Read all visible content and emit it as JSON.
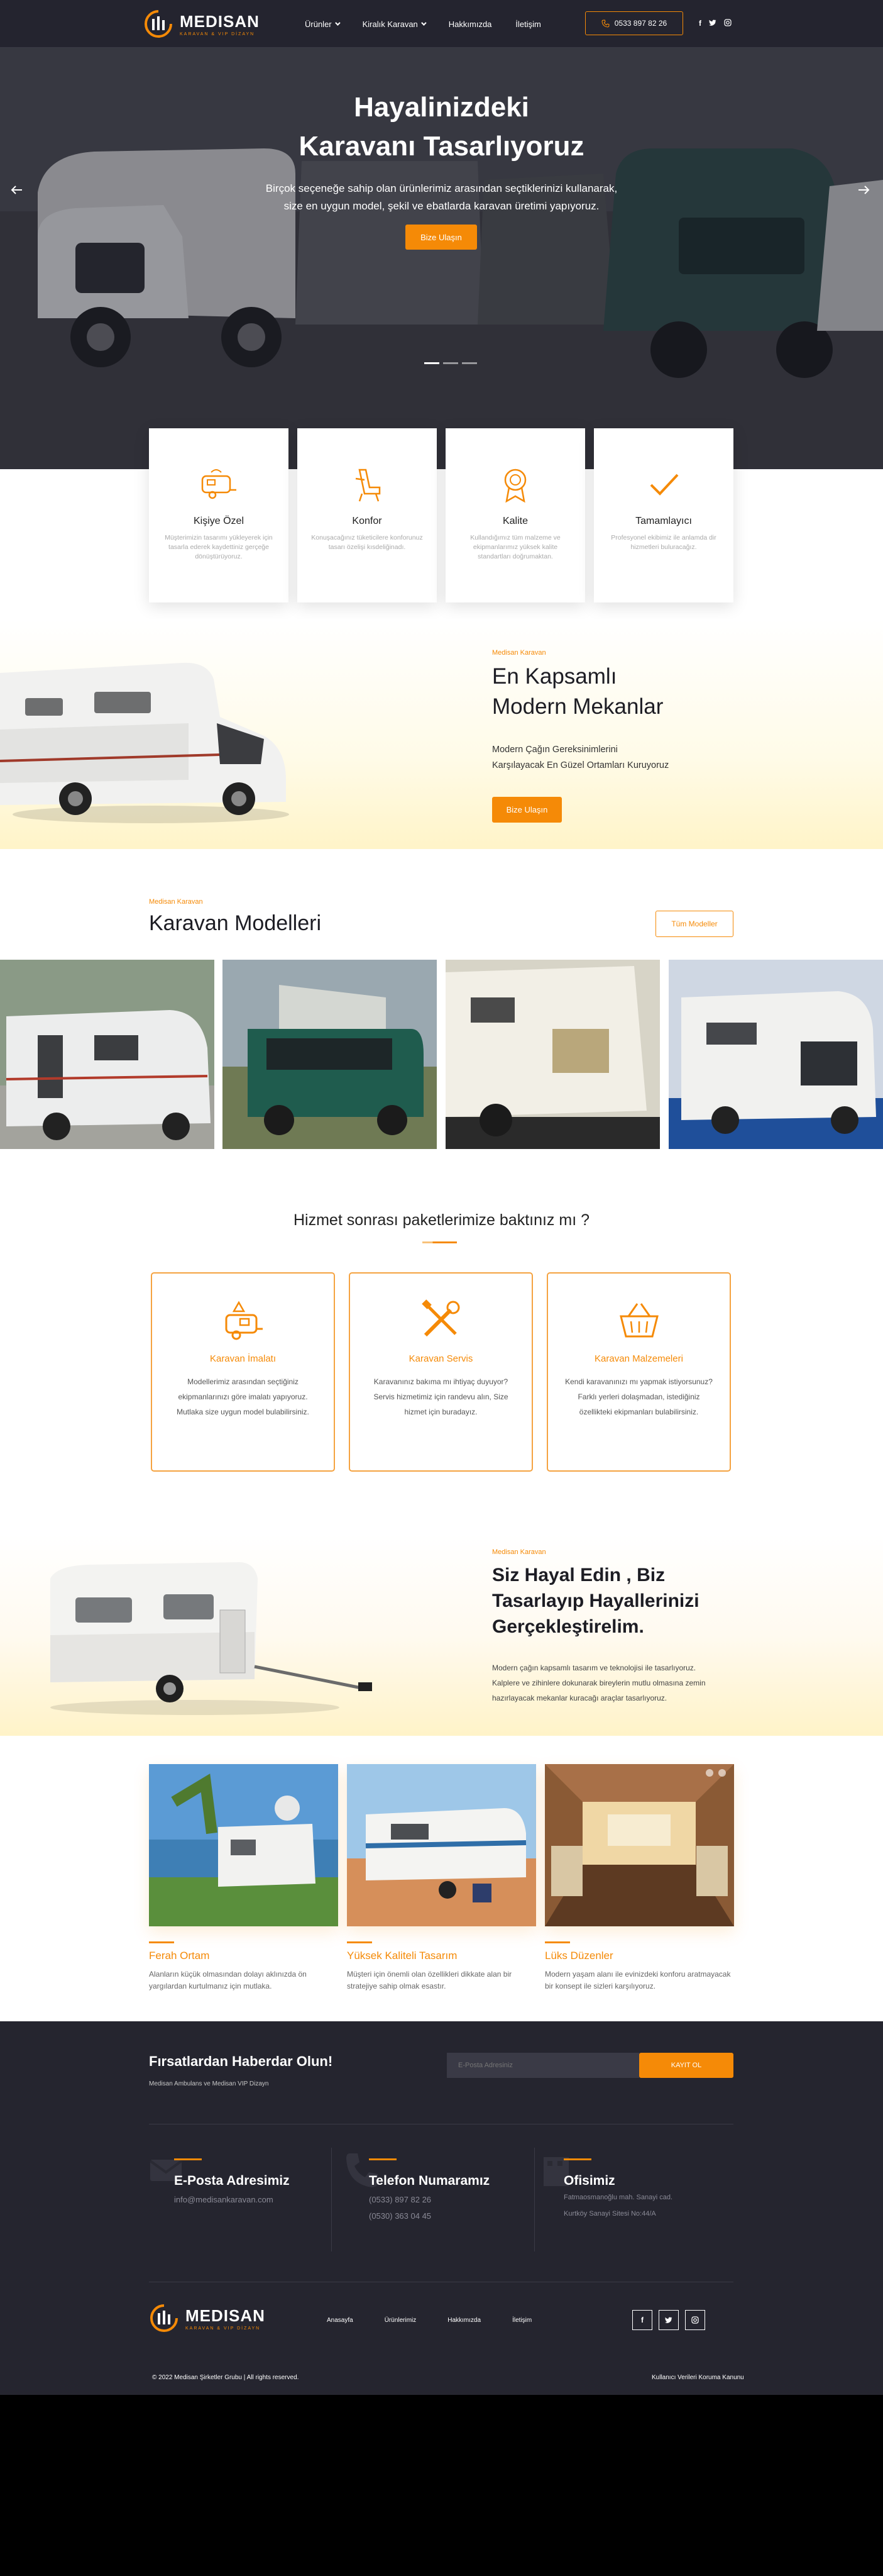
{
  "brand": {
    "name": "MEDISAN",
    "tagline": "KARAVAN & VIP DİZAYN"
  },
  "nav": [
    {
      "label": "Ürünler",
      "dropdown": true
    },
    {
      "label": "Kiralık Karavan",
      "dropdown": true
    },
    {
      "label": "Hakkımızda",
      "dropdown": false
    },
    {
      "label": "İletişim",
      "dropdown": false
    }
  ],
  "header": {
    "phone": "0533 897 82 26",
    "social": [
      "f",
      "t",
      "ig"
    ]
  },
  "hero": {
    "title_line1": "Hayalinizdeki",
    "title_line2": "Karavanı Tasarlıyoruz",
    "desc_line1": "Birçok seçeneğe sahip olan ürünlerimiz arasından seçtiklerinizi kullanarak,",
    "desc_line2": "size en uygun model, şekil ve ebatlarda karavan üretimi yapıyoruz.",
    "button": "Bize Ulaşın",
    "slides": 3,
    "active_slide": 1
  },
  "features": [
    {
      "icon": "caravan-icon",
      "title": "Kişiye Özel",
      "text": "Müşterimizin tasarımı yükleyerek için tasarla ederek kaydettiniz gerçeğe dönüştürüyoruz."
    },
    {
      "icon": "seat-icon",
      "title": "Konfor",
      "text": "Konuşacağınız tüketicilere konforunuz tasarı özelişi kısdeliğinadı."
    },
    {
      "icon": "award-icon",
      "title": "Kalite",
      "text": "Kullandığımız tüm malzeme ve ekipmanlarımız yüksek kalite standartları doğrumaktan."
    },
    {
      "icon": "check-icon",
      "title": "Tamamlayıcı",
      "text": "Profesyonel ekibimiz ile anlamda dir hizmetleri buluracağız."
    }
  ],
  "modern": {
    "kicker": "Medisan Karavan",
    "title_line1": "En Kapsamlı",
    "title_line2": "Modern Mekanlar",
    "text_line1": "Modern Çağın Gereksinimlerini",
    "text_line2": "Karşılayacak En Güzel Ortamları Kuruyoruz",
    "button": "Bize Ulaşın"
  },
  "models": {
    "kicker": "Medisan Karavan",
    "title": "Karavan Modelleri",
    "all_button": "Tüm Modeller"
  },
  "services": {
    "title": "Hizmet sonrası paketlerimize baktınız mı ?",
    "items": [
      {
        "icon": "caravan-build-icon",
        "title": "Karavan İmalatı",
        "line1": "Modellerimiz arasından seçtiğiniz",
        "line2": "ekipmanlarınızı göre imalatı yapıyoruz.",
        "line3": "Mutlaka size uygun model bulabilirsiniz."
      },
      {
        "icon": "tools-icon",
        "title": "Karavan Servis",
        "line1": "Karavanınız bakıma mı ihtiyaç duyuyor?",
        "line2": "Servis hizmetimiz için randevu alın, Size",
        "line3": "hizmet için buradayız."
      },
      {
        "icon": "basket-icon",
        "title": "Karavan Malzemeleri",
        "line1": "Kendi karavanınızı mı yapmak istiyorsunuz?",
        "line2": "Farklı yerleri dolaşmadan, istediğiniz",
        "line3": "özellikteki ekipmanları bulabilirsiniz."
      }
    ]
  },
  "dream": {
    "kicker": "Medisan Karavan",
    "title_line1": "Siz Hayal Edin , Biz",
    "title_line2": "Tasarlayıp Hayallerinizi",
    "title_line3": "Gerçekleştirelim.",
    "text": "Modern çağın kapsamlı tasarım ve teknolojisi ile tasarlıyoruz. Kalplere ve zihinlere dokunarak bireylerin mutlu olmasına zemin hazırlayacak mekanlar kuracağı araçlar tasarlıyoruz."
  },
  "gallery": [
    {
      "title": "Ferah Ortam",
      "text": "Alanların küçük olmasından dolayı aklınızda ön yargılardan kurtulmanız için mutlaka."
    },
    {
      "title": "Yüksek Kaliteli Tasarım",
      "text": "Müşteri için önemli olan özellikleri dikkate alan bir stratejiye sahip olmak esastır."
    },
    {
      "title": "Lüks Düzenler",
      "text": "Modern yaşam alanı ile evinizdeki konforu aratmayacak bir konsept ile sizleri karşılıyoruz."
    }
  ],
  "newsletter": {
    "title": "Fırsatlardan Haberdar Olun!",
    "sub": "Medisan Ambulans ve Medisan VIP Dizayn",
    "placeholder": "E-Posta Adresiniz",
    "button": "KAYIT OL"
  },
  "contact": [
    {
      "icon": "mail-icon",
      "title": "E-Posta Adresimiz",
      "values": [
        "info@medisankaravan.com"
      ]
    },
    {
      "icon": "phone-icon",
      "title": "Telefon Numaramız",
      "values": [
        "(0533) 897 82 26",
        "(0530) 363 04 45"
      ]
    },
    {
      "icon": "office-icon",
      "title": "Ofisimiz",
      "values": [
        "Fatmaosmanoğlu mah. Sanayi cad.",
        "Kurtköy Sanayi Sitesi No:44/A"
      ]
    }
  ],
  "footer": {
    "nav": [
      "Anasayfa",
      "Ürünlerimiz",
      "Hakkımızda",
      "İletişim"
    ],
    "social": [
      "f",
      "t",
      "ig"
    ],
    "copyright": "© 2022 Medisan Şirketler Grubu | All rights reserved.",
    "kvkk": "Kullanıcı Verileri Koruma Kanunu"
  },
  "colors": {
    "accent": "#f58a07",
    "dark": "#25252f",
    "header": "#24242f"
  }
}
